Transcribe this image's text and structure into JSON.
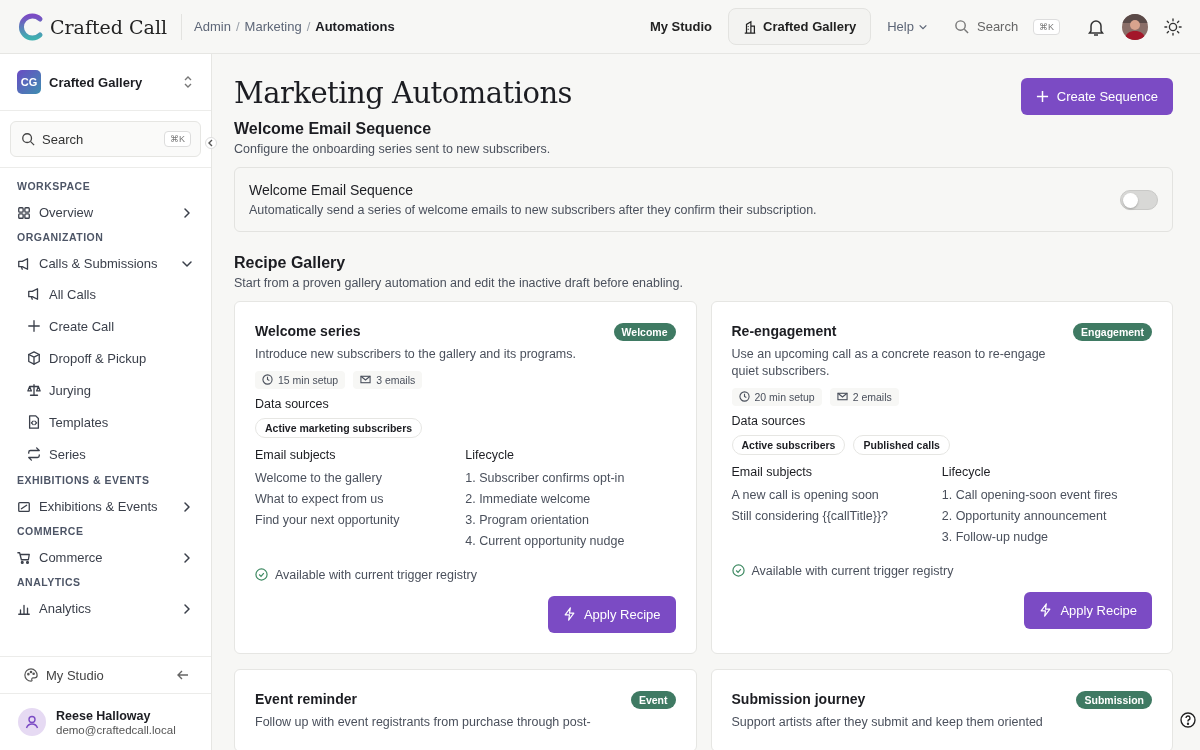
{
  "header": {
    "logo": "Crafted Call",
    "breadcrumb_separator": "/",
    "breadcrumbs": [
      {
        "label": "Admin",
        "current": false
      },
      {
        "label": "Marketing",
        "current": false
      },
      {
        "label": "Automations",
        "current": true
      }
    ],
    "nav": [
      {
        "label": "My Studio",
        "kind": "link"
      },
      {
        "label": "Crafted Gallery",
        "kind": "org"
      },
      {
        "label": "Help",
        "kind": "menu"
      }
    ],
    "search": {
      "placeholder": "Search",
      "shortcut": "⌘K"
    }
  },
  "sidebar": {
    "org": {
      "initials": "CG",
      "name": "Crafted Gallery"
    },
    "search": {
      "placeholder": "Search",
      "shortcut": "⌘K"
    },
    "sections": [
      {
        "heading": "WORKSPACE",
        "items": [
          {
            "label": "Overview",
            "expanded": false
          }
        ]
      },
      {
        "heading": "ORGANIZATION",
        "items": [
          {
            "label": "Calls & Submissions",
            "expanded": true,
            "children": [
              {
                "label": "All Calls"
              },
              {
                "label": "Create Call"
              },
              {
                "label": "Dropoff & Pickup"
              },
              {
                "label": "Jurying"
              },
              {
                "label": "Templates"
              },
              {
                "label": "Series"
              }
            ]
          }
        ]
      },
      {
        "heading": "EXHIBITIONS & EVENTS",
        "items": [
          {
            "label": "Exhibitions & Events",
            "expanded": false
          }
        ]
      },
      {
        "heading": "COMMERCE",
        "items": [
          {
            "label": "Commerce",
            "expanded": false
          }
        ]
      },
      {
        "heading": "ANALYTICS",
        "items": [
          {
            "label": "Analytics",
            "expanded": false
          }
        ]
      }
    ],
    "footer_link": "My Studio",
    "user": {
      "name": "Reese Halloway",
      "email": "demo@craftedcall.local"
    }
  },
  "page": {
    "title": "Marketing Automations",
    "primary_action": "Create Sequence",
    "sequence_section": {
      "title": "Welcome Email Sequence",
      "subtitle": "Configure the onboarding series sent to new subscribers.",
      "setting": {
        "title": "Welcome Email Sequence",
        "description": "Automatically send a series of welcome emails to new subscribers after they confirm their subscription.",
        "on": false
      }
    },
    "gallery": {
      "title": "Recipe Gallery",
      "subtitle": "Start from a proven gallery automation and edit the inactive draft before enabling.",
      "recipes": [
        {
          "title": "Welcome series",
          "tag": "Welcome",
          "description": "Introduce new subscribers to the gallery and its programs.",
          "setup": "15 min setup",
          "emails": "3 emails",
          "sources_label": "Data sources",
          "sources": [
            "Active marketing subscribers"
          ],
          "subjects_label": "Email subjects",
          "subjects": [
            "Welcome to the gallery",
            "What to expect from us",
            "Find your next opportunity"
          ],
          "lifecycle_label": "Lifecycle",
          "lifecycle": [
            "1. Subscriber confirms opt-in",
            "2. Immediate welcome",
            "3. Program orientation",
            "4. Current opportunity nudge"
          ],
          "availability": "Available with current trigger registry",
          "action": "Apply Recipe"
        },
        {
          "title": "Re-engagement",
          "tag": "Engagement",
          "description": "Use an upcoming call as a concrete reason to re-engage quiet subscribers.",
          "setup": "20 min setup",
          "emails": "2 emails",
          "sources_label": "Data sources",
          "sources": [
            "Active subscribers",
            "Published calls"
          ],
          "subjects_label": "Email subjects",
          "subjects": [
            "A new call is opening soon",
            "Still considering {{callTitle}}?"
          ],
          "lifecycle_label": "Lifecycle",
          "lifecycle": [
            "1. Call opening-soon event fires",
            "2. Opportunity announcement",
            "3. Follow-up nudge"
          ],
          "availability": "Available with current trigger registry",
          "action": "Apply Recipe"
        },
        {
          "title": "Event reminder",
          "tag": "Event",
          "description": "Follow up with event registrants from purchase through post-"
        },
        {
          "title": "Submission journey",
          "tag": "Submission",
          "description": "Support artists after they submit and keep them oriented"
        }
      ]
    }
  }
}
